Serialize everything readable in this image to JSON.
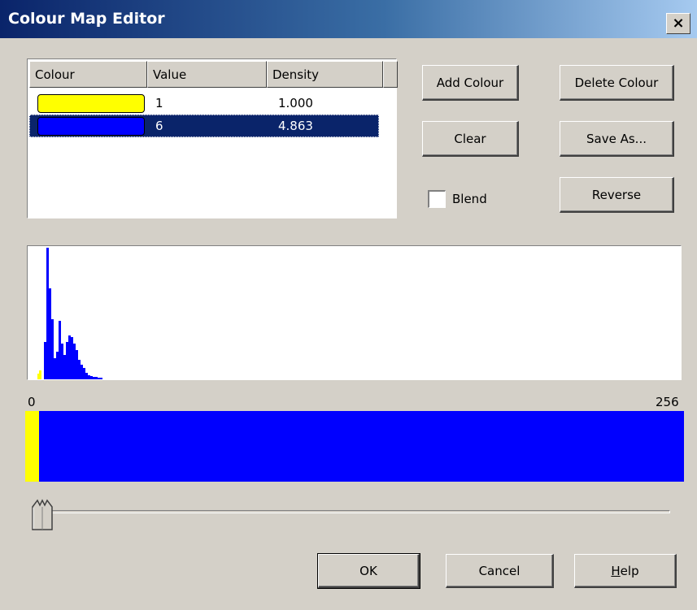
{
  "window": {
    "title": "Colour Map Editor",
    "close_label": "×"
  },
  "list": {
    "columns": [
      "Colour",
      "Value",
      "Density"
    ],
    "rows": [
      {
        "colour": "#ffff00",
        "value": "1",
        "density": "1.000",
        "selected": false
      },
      {
        "colour": "#0000ff",
        "value": "6",
        "density": "4.863",
        "selected": true
      }
    ]
  },
  "buttons": {
    "add_colour": "Add Colour",
    "delete_colour": "Delete Colour",
    "clear": "Clear",
    "save_as": "Save As...",
    "reverse": "Reverse",
    "ok": "OK",
    "cancel": "Cancel",
    "help": "Help"
  },
  "blend": {
    "label": "Blend",
    "checked": false
  },
  "range": {
    "min": "0",
    "max": "256"
  },
  "colors": {
    "yellow": "#ffff00",
    "blue": "#0000ff",
    "selection": "#0a246a",
    "dialog_bg": "#d4d0c8"
  },
  "slider": {
    "value": 0
  }
}
